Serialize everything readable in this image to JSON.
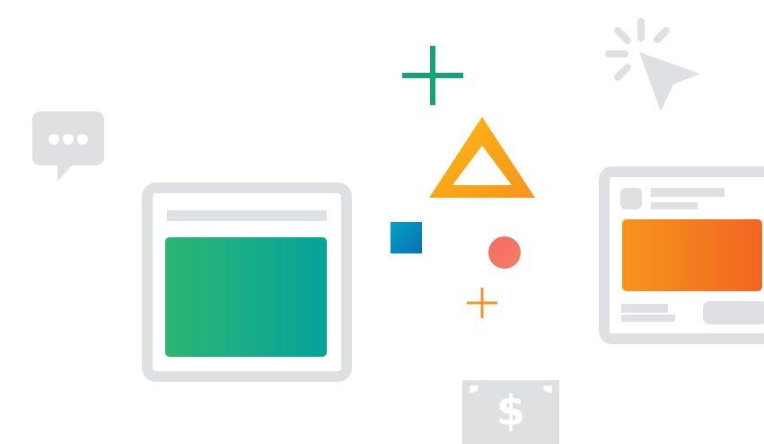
{
  "colors": {
    "gray": "#DFE0E2",
    "green_start": "#2BB673",
    "green_end": "#05A39B",
    "orange_start": "#F7941D",
    "orange_end": "#F26522",
    "triangle_start": "#FDB913",
    "triangle_end": "#F7941D",
    "square_start": "#00A3C4",
    "square_end": "#0E6DB7",
    "circle": "#F26D5B",
    "plus_green": "#16A37A",
    "plus_orange": "#F7941D"
  },
  "icons": {
    "chat": "chat-bubble-icon",
    "cursor": "cursor-click-icon",
    "money": "dollar-bill-icon",
    "currency_symbol": "$"
  }
}
